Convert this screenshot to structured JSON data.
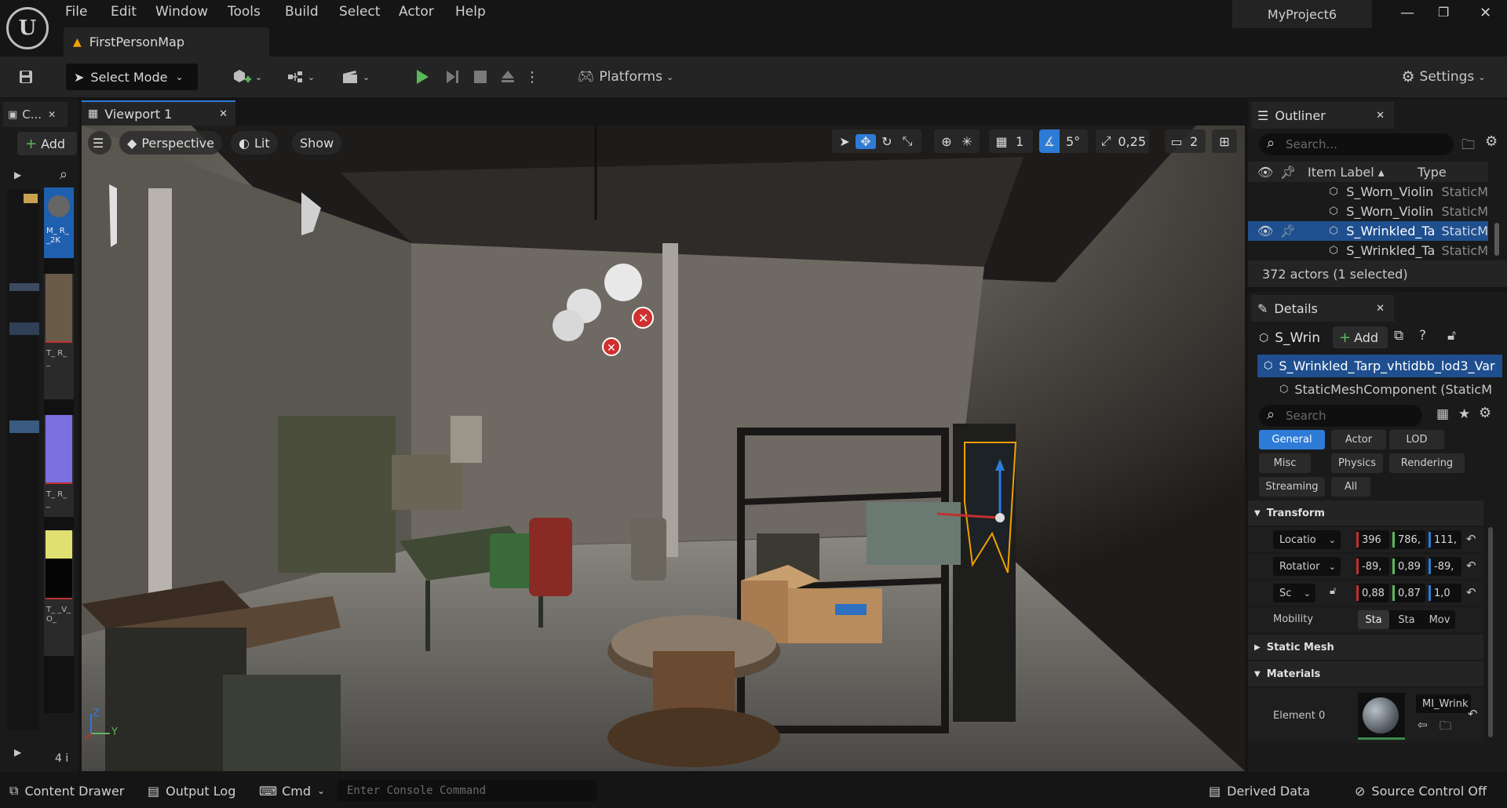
{
  "menubar": {
    "items": [
      "File",
      "Edit",
      "Window",
      "Tools",
      "Build",
      "Select",
      "Actor",
      "Help"
    ],
    "map_tab": "FirstPersonMap",
    "project_name": "MyProject6"
  },
  "toolbar": {
    "select_mode": "Select Mode",
    "platforms": "Platforms",
    "settings": "Settings"
  },
  "left_panel": {
    "tab_label": "C...",
    "add_label": "Add",
    "asset_labels": [
      "M_ R_ _2K",
      "T_ R_ _",
      "T_ R_ _",
      "T_ _V_ O_"
    ],
    "count": "4 i"
  },
  "viewport": {
    "tab_label": "Viewport 1",
    "perspective": "Perspective",
    "lit": "Lit",
    "show": "Show",
    "grid_value": "1",
    "angle_value": "5°",
    "scale_value": "0,25",
    "camera_speed": "2",
    "axis_z": "Z",
    "axis_y": "Y"
  },
  "outliner": {
    "title": "Outliner",
    "search_placeholder": "Search...",
    "col_label": "Item Label ▴",
    "col_type": "Type",
    "rows": [
      {
        "label": "S_Worn_Violin",
        "type": "StaticM",
        "selected": false
      },
      {
        "label": "S_Worn_Violin",
        "type": "StaticM",
        "selected": false
      },
      {
        "label": "S_Wrinkled_Ta",
        "type": "StaticM",
        "selected": true
      },
      {
        "label": "S_Wrinkled_Ta",
        "type": "StaticM",
        "selected": false
      }
    ],
    "count": "372 actors (1 selected)"
  },
  "details": {
    "title": "Details",
    "actor_name": "S_Wrin",
    "add_label": "Add",
    "component_root": "S_Wrinkled_Tarp_vhtidbb_lod3_Var",
    "component_child": "StaticMeshComponent (StaticM",
    "search_placeholder": "Search",
    "categories": [
      "General",
      "Actor",
      "LOD",
      "Misc",
      "Physics",
      "Rendering",
      "Streaming",
      "All"
    ],
    "transform_header": "Transform",
    "location_label": "Locatio",
    "location_values": [
      "396",
      "786,",
      "111,"
    ],
    "rotation_label": "Rotatior",
    "rotation_values": [
      "-89,",
      "0,89",
      "-89,"
    ],
    "scale_label": "Sc",
    "scale_values": [
      "0,88",
      "0,87",
      "1,0"
    ],
    "mobility_label": "Mobility",
    "mobility_options": [
      "Sta",
      "Sta",
      "Mov"
    ],
    "static_mesh_header": "Static Mesh",
    "materials_header": "Materials",
    "element_label": "Element 0",
    "material_name": "MI_Wrink"
  },
  "statusbar": {
    "content_drawer": "Content Drawer",
    "output_log": "Output Log",
    "cmd": "Cmd",
    "console_placeholder": "Enter Console Command",
    "derived_data": "Derived Data",
    "source_control": "Source Control Off"
  },
  "colors": {
    "accent": "#2d7bd6",
    "play_green": "#5cb85c",
    "selection_orange": "#f0a000"
  }
}
